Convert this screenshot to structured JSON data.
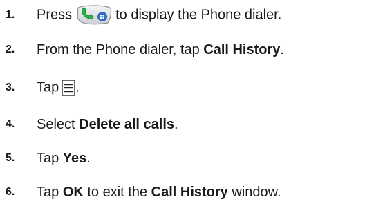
{
  "steps": [
    {
      "num": "1.",
      "pre": "Press",
      "icon": "phone-key-icon",
      "post": "to display the Phone dialer."
    },
    {
      "num": "2.",
      "pre": "From the Phone dialer, tap ",
      "bold": "Call History",
      "post": "."
    },
    {
      "num": "3.",
      "pre": "Tap",
      "icon": "menu-icon",
      "post": "."
    },
    {
      "num": "4.",
      "pre": "Select ",
      "bold": "Delete all calls",
      "post": "."
    },
    {
      "num": "5.",
      "pre": "Tap ",
      "bold": "Yes",
      "post": "."
    },
    {
      "num": "6.",
      "pre": "Tap ",
      "bold": "OK",
      "mid": " to exit the ",
      "bold2": "Call History",
      "post": " window."
    }
  ]
}
